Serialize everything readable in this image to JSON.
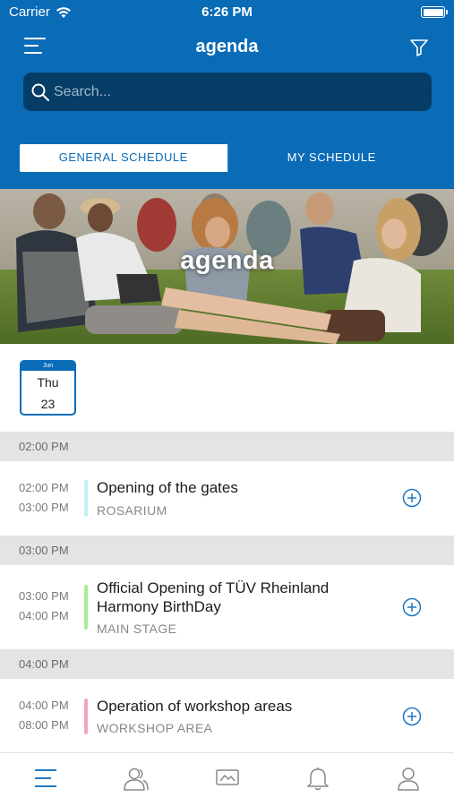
{
  "status_bar": {
    "carrier": "Carrier",
    "time": "6:26 PM"
  },
  "nav": {
    "title": "agenda"
  },
  "search": {
    "placeholder": "Search..."
  },
  "segments": [
    {
      "label": "GENERAL SCHEDULE",
      "active": true
    },
    {
      "label": "MY SCHEDULE",
      "active": false
    }
  ],
  "hero": {
    "title": "agenda"
  },
  "date": {
    "month": "Jun",
    "weekday": "Thu",
    "day": "23"
  },
  "groups": [
    {
      "header": "02:00 PM",
      "events": [
        {
          "start": "02:00 PM",
          "end": "03:00 PM",
          "title": "Opening of the gates",
          "location": "ROSARIUM",
          "color": "#bff1f7"
        }
      ]
    },
    {
      "header": "03:00 PM",
      "events": [
        {
          "start": "03:00 PM",
          "end": "04:00 PM",
          "title": "Official Opening of TÜV Rheinland Harmony BirthDay",
          "location": "MAIN STAGE",
          "color": "#a6ee8f"
        }
      ]
    },
    {
      "header": "04:00 PM",
      "events": [
        {
          "start": "04:00 PM",
          "end": "08:00 PM",
          "title": "Operation of workshop areas",
          "location": "WORKSHOP AREA",
          "color": "#f3a6b8"
        }
      ]
    }
  ],
  "colors": {
    "header_blue": "#0a6bb7",
    "search_bg": "#063d66",
    "divider_gray": "#e4e4e4"
  },
  "tabs": [
    {
      "icon": "agenda-list-icon",
      "active": true
    },
    {
      "icon": "people-icon",
      "active": false
    },
    {
      "icon": "gallery-icon",
      "active": false
    },
    {
      "icon": "bell-icon",
      "active": false
    },
    {
      "icon": "profile-icon",
      "active": false
    }
  ]
}
